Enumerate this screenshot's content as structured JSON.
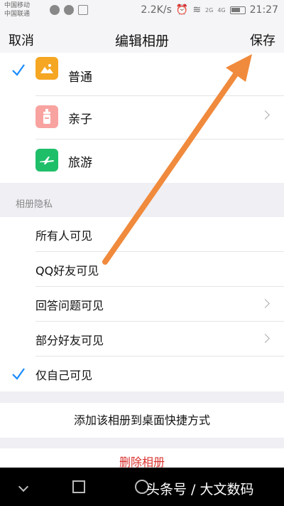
{
  "status_bar": {
    "carrier1": "中国移动",
    "carrier2": "中国联通",
    "speed": "2.2K/s",
    "net1": "2G",
    "net2": "4G",
    "time": "21:27"
  },
  "nav": {
    "cancel_label": "取消",
    "title": "编辑相册",
    "save_label": "保存"
  },
  "categories": [
    {
      "label": "普通",
      "selected": true,
      "color": "#f5a623",
      "icon": "landscape-icon"
    },
    {
      "label": "亲子",
      "selected": false,
      "color": "#f8a3a0",
      "icon": "baby-bottle-icon"
    },
    {
      "label": "旅游",
      "selected": false,
      "color": "#1fbf6a",
      "icon": "airplane-icon"
    }
  ],
  "privacy": {
    "header": "相册隐私",
    "options": [
      {
        "label": "所有人可见",
        "selected": false,
        "has_chevron": false
      },
      {
        "label": "QQ好友可见",
        "selected": false,
        "has_chevron": false
      },
      {
        "label": "回答问题可见",
        "selected": false,
        "has_chevron": true
      },
      {
        "label": "部分好友可见",
        "selected": false,
        "has_chevron": true
      },
      {
        "label": "仅自己可见",
        "selected": true,
        "has_chevron": false
      }
    ]
  },
  "shortcut_label": "添加该相册到桌面快捷方式",
  "delete_label": "删除相册",
  "watermark": "头条号 / 大文数码",
  "colors": {
    "check": "#1a8cff",
    "delete": "#d9312c",
    "annotation_arrow": "#f08a3c"
  }
}
